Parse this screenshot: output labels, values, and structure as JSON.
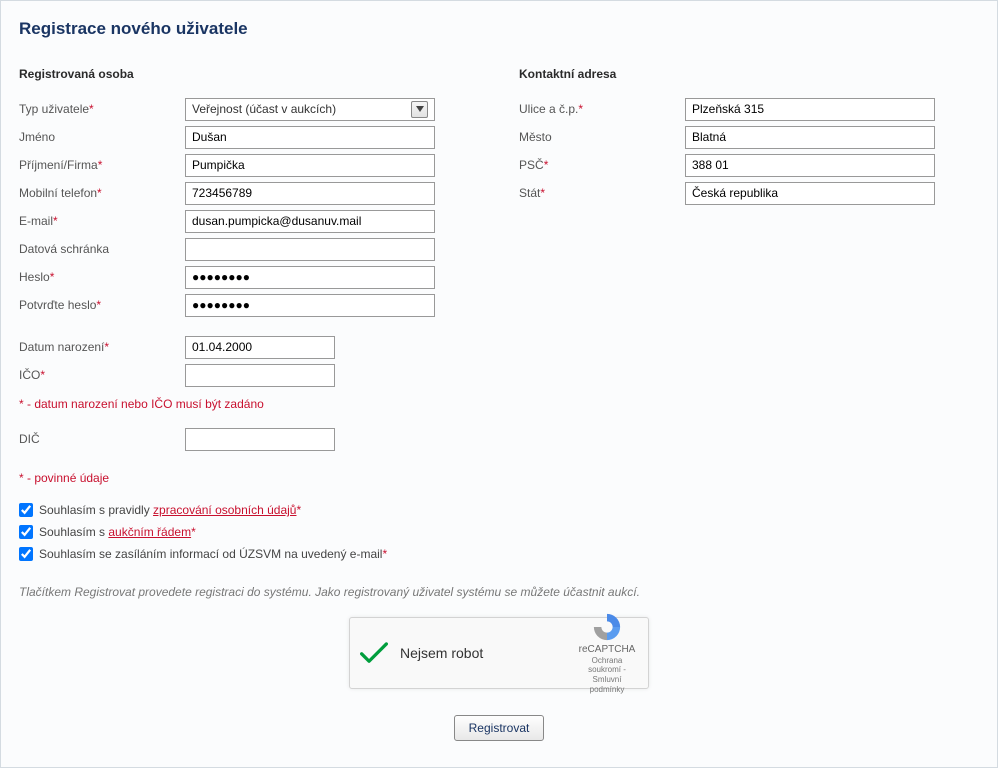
{
  "page_title": "Registrace nového uživatele",
  "sections": {
    "person_title": "Registrovaná osoba",
    "contact_title": "Kontaktní adresa"
  },
  "labels": {
    "user_type": "Typ uživatele",
    "first_name": "Jméno",
    "surname_company": "Příjmení/Firma",
    "mobile": "Mobilní telefon",
    "email": "E-mail",
    "databox": "Datová schránka",
    "password": "Heslo",
    "password_confirm": "Potvrďte heslo",
    "dob": "Datum narození",
    "ico": "IČO",
    "dic": "DIČ",
    "street": "Ulice a č.p.",
    "city": "Město",
    "zip": "PSČ",
    "country": "Stát"
  },
  "values": {
    "user_type_selected": "Veřejnost (účast v aukcích)",
    "first_name": "Dušan",
    "surname_company": "Pumpička",
    "mobile": "723456789",
    "email": "dusan.pumpicka@dusanuv.mail",
    "databox": "",
    "password": "●●●●●●●●",
    "password_confirm": "●●●●●●●●",
    "dob": "01.04.2000",
    "ico": "",
    "dic": "",
    "street": "Plzeňská 315",
    "city": "Blatná",
    "zip": "388 01",
    "country": "Česká republika"
  },
  "notes": {
    "dob_or_ico": "* - datum narození nebo IČO musí být zadáno",
    "required": "* - povinné údaje"
  },
  "consents": {
    "c1_pre": "Souhlasím s pravidly ",
    "c1_link": "zpracování osobních údajů",
    "c2_pre": "Souhlasím s ",
    "c2_link": "aukčním řádem",
    "c3": "Souhlasím se zasíláním informací od ÚZSVM na uvedený e-mail"
  },
  "hint_italic": "Tlačítkem Registrovat provedete registraci do systému. Jako registrovaný uživatel systému se můžete účastnit aukcí.",
  "captcha": {
    "label": "Nejsem robot",
    "brand": "reCAPTCHA",
    "sub": "Ochrana soukromí - Smluvní podmínky"
  },
  "submit_label": "Registrovat"
}
